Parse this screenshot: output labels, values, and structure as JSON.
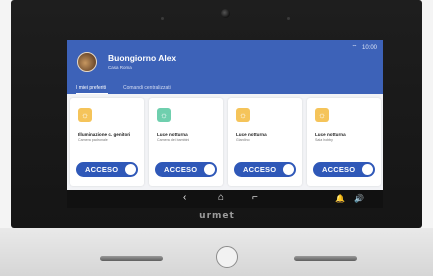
{
  "brand": "urmet",
  "header": {
    "greeting": "Buongiorno Alex",
    "location": "Casa Roma",
    "status_time": "10:00"
  },
  "tabs": [
    {
      "label": "I miei preferiti",
      "active": true
    },
    {
      "label": "Comandi centralizzati",
      "active": false
    }
  ],
  "cards": [
    {
      "title": "Illuminazione c. genitori",
      "subtitle": "Camera padronale",
      "state": "ACCESO",
      "icon": "bulb-icon",
      "icon_color": "#f5c45a"
    },
    {
      "title": "Luce notturna",
      "subtitle": "Camera dei bambini",
      "state": "ACCESO",
      "icon": "bulb-icon",
      "icon_color": "#6fcfae"
    },
    {
      "title": "Luce notturna",
      "subtitle": "Giardino",
      "state": "ACCESO",
      "icon": "bulb-icon",
      "icon_color": "#f5c45a"
    },
    {
      "title": "Luce notturna",
      "subtitle": "Sala hobby",
      "state": "ACCESO",
      "icon": "bulb-icon",
      "icon_color": "#f5c45a"
    }
  ],
  "navbar": {
    "back": "‹",
    "home": "⌂",
    "recent": "⌐",
    "bell": "🔔",
    "volume": "🔊"
  },
  "colors": {
    "header_blue": "#3d62b8",
    "toggle_blue": "#2f58b8"
  }
}
